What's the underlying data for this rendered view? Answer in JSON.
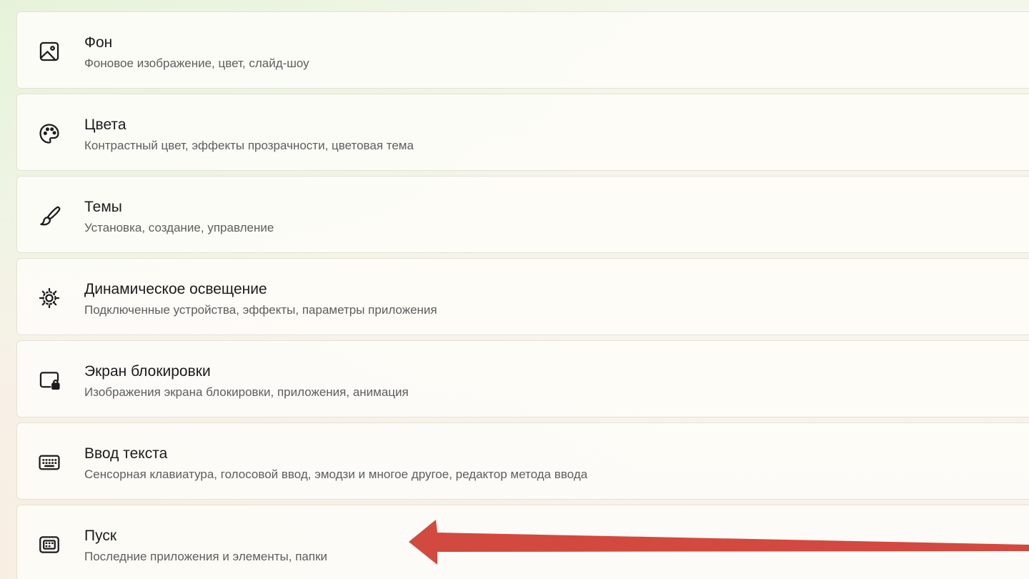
{
  "settings_list": {
    "items": [
      {
        "id": "background",
        "icon": "image-icon",
        "title": "Фон",
        "subtitle": "Фоновое изображение, цвет, слайд-шоу"
      },
      {
        "id": "colors",
        "icon": "palette-icon",
        "title": "Цвета",
        "subtitle": "Контрастный цвет, эффекты прозрачности, цветовая тема"
      },
      {
        "id": "themes",
        "icon": "brush-icon",
        "title": "Темы",
        "subtitle": "Установка, создание, управление"
      },
      {
        "id": "dynamic-lighting",
        "icon": "lighting-icon",
        "title": "Динамическое освещение",
        "subtitle": "Подключенные устройства, эффекты, параметры приложения"
      },
      {
        "id": "lock-screen",
        "icon": "lock-screen-icon",
        "title": "Экран блокировки",
        "subtitle": "Изображения экрана блокировки, приложения, анимация"
      },
      {
        "id": "text-input",
        "icon": "keyboard-icon",
        "title": "Ввод текста",
        "subtitle": "Сенсорная клавиатура, голосовой ввод, эмодзи и многое другое, редактор метода ввода"
      },
      {
        "id": "start",
        "icon": "start-menu-icon",
        "title": "Пуск",
        "subtitle": "Последние приложения и элементы, папки"
      }
    ]
  },
  "annotation": {
    "type": "arrow",
    "color": "#d2493f",
    "points_to": "start"
  }
}
